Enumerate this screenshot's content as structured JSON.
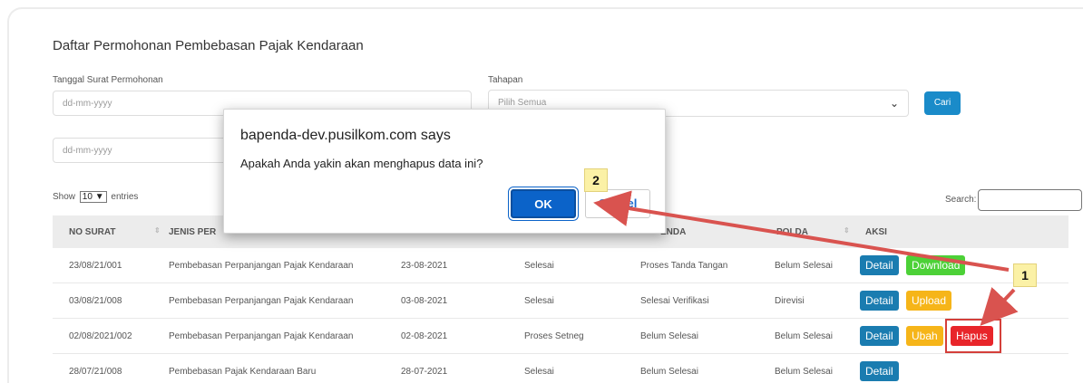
{
  "page_title": "Daftar Permohonan Pembebasan Pajak Kendaraan",
  "filters": {
    "date_label": "Tanggal Surat Permohonan",
    "date_from_placeholder": "dd-mm-yyyy",
    "date_to_placeholder": "dd-mm-yyyy",
    "stage_label": "Tahapan",
    "stage_value": "Pilih Semua",
    "search_button": "Cari"
  },
  "table_controls": {
    "show_prefix": "Show",
    "show_value": "10",
    "show_suffix": "entries",
    "search_label": "Search:"
  },
  "table": {
    "headers": [
      "NO SURAT",
      "JENIS PER",
      "",
      "",
      "ENDA",
      "POLDA",
      "AKSI"
    ],
    "rows": [
      {
        "no": "23/08/21/001",
        "jenis": "Pembebasan Perpanjangan Pajak Kendaraan",
        "tanggal": "23-08-2021",
        "tahapan": "Selesai",
        "status": "Proses Tanda Tangan",
        "polda": "Belum Selesai",
        "actions": [
          "Detail",
          "Download"
        ]
      },
      {
        "no": "03/08/21/008",
        "jenis": "Pembebasan Perpanjangan Pajak Kendaraan",
        "tanggal": "03-08-2021",
        "tahapan": "Selesai",
        "status": "Selesai Verifikasi",
        "polda": "Direvisi",
        "actions": [
          "Detail",
          "Upload"
        ]
      },
      {
        "no": "02/08/2021/002",
        "jenis": "Pembebasan Perpanjangan Pajak Kendaraan",
        "tanggal": "02-08-2021",
        "tahapan": "Proses Setneg",
        "status": "Belum Selesai",
        "polda": "Belum Selesai",
        "actions": [
          "Detail",
          "Ubah",
          "Hapus"
        ]
      },
      {
        "no": "28/07/21/008",
        "jenis": "Pembebasan Pajak Kendaraan Baru",
        "tanggal": "28-07-2021",
        "tahapan": "Selesai",
        "status": "Belum Selesai",
        "polda": "Belum Selesai",
        "actions": [
          "Detail"
        ]
      }
    ]
  },
  "dialog": {
    "title": "bapenda-dev.pusilkom.com says",
    "message": "Apakah Anda yakin akan menghapus data ini?",
    "ok": "OK",
    "cancel": "Cancel"
  },
  "annotations": {
    "step1": "1",
    "step2": "2",
    "arrow_color": "#d9534f"
  }
}
